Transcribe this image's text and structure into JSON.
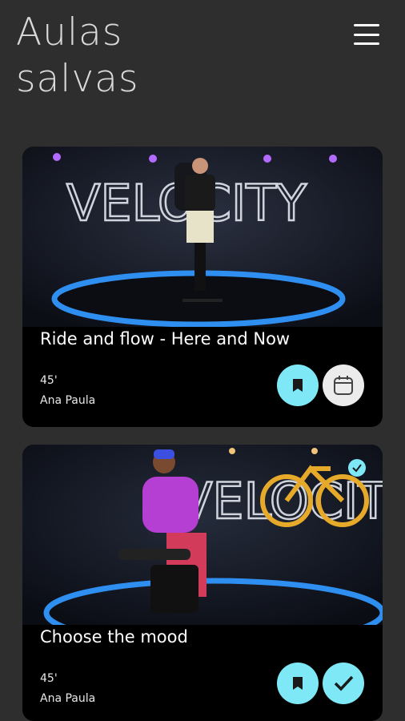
{
  "header": {
    "title": "Aulas salvas"
  },
  "classes": [
    {
      "title": "Ride and flow - Here and Now",
      "duration": "45'",
      "instructor": "Ana Paula",
      "brand": "VELOCITY"
    },
    {
      "title": "Choose the mood",
      "duration": "45'",
      "instructor": "Ana Paula",
      "brand": "VELOCITY"
    }
  ],
  "colors": {
    "background": "#2e2e2e",
    "card": "#000000",
    "accent": "#7fe8f7",
    "logo_gold": "#e6a92a"
  },
  "icons": {
    "menu": "hamburger-menu-icon",
    "save": "bookmark-icon",
    "schedule": "calendar-icon",
    "done": "checkmark-icon"
  }
}
